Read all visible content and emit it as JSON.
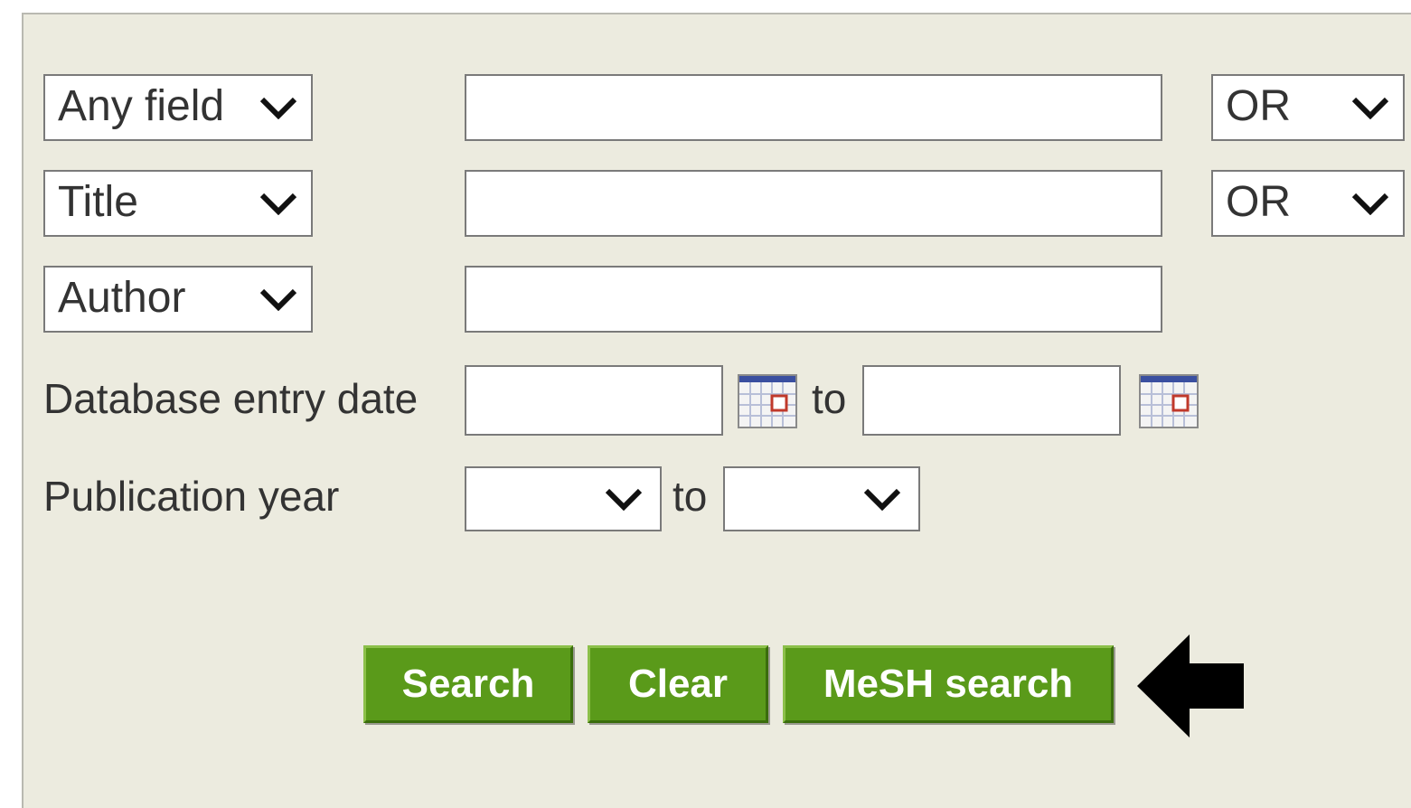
{
  "rows": [
    {
      "field": "Any field",
      "operator": "OR"
    },
    {
      "field": "Title",
      "operator": "OR"
    },
    {
      "field": "Author"
    }
  ],
  "entry_date": {
    "label": "Database entry date",
    "to_label": "to"
  },
  "publication_year": {
    "label": "Publication year",
    "to_label": "to"
  },
  "buttons": {
    "search": "Search",
    "clear": "Clear",
    "mesh_search": "MeSH search"
  },
  "colors": {
    "panel_bg": "#ecebdf",
    "button_green": "#5a9a1a",
    "button_text": "#ffffff"
  },
  "icons": {
    "calendar": "calendar-icon",
    "chevron": "chevron-down-icon",
    "pointer": "arrow-left-icon"
  }
}
